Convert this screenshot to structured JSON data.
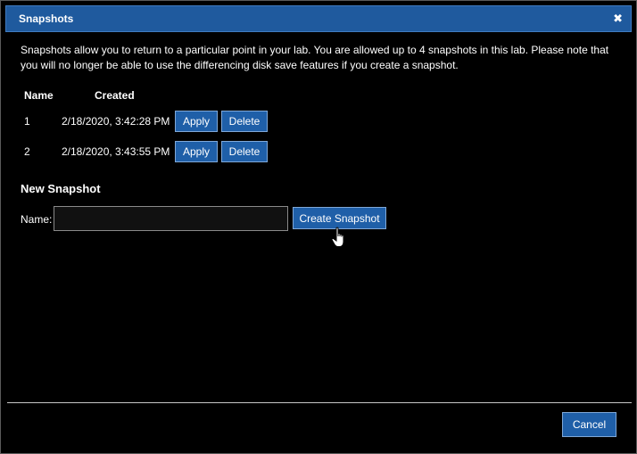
{
  "dialog": {
    "title": "Snapshots",
    "close_icon": "close-icon",
    "description": "Snapshots allow you to return to a particular point in your lab. You are allowed up to 4 snapshots in this lab. Please note that you will no longer be able to use the differencing disk save features if you create a snapshot."
  },
  "table": {
    "headers": {
      "name": "Name",
      "created": "Created"
    },
    "rows": [
      {
        "name": "1",
        "created": "2/18/2020, 3:42:28 PM",
        "apply": "Apply",
        "delete": "Delete"
      },
      {
        "name": "2",
        "created": "2/18/2020, 3:43:55 PM",
        "apply": "Apply",
        "delete": "Delete"
      }
    ]
  },
  "new_snapshot": {
    "title": "New Snapshot",
    "name_label": "Name:",
    "name_value": "",
    "name_placeholder": "",
    "create_label": "Create Snapshot"
  },
  "footer": {
    "cancel_label": "Cancel"
  },
  "colors": {
    "title_bar": "#1f5a9e",
    "button": "#1f5fa8",
    "background": "#000000",
    "text": "#ffffff"
  },
  "icons": {
    "close": "close-icon",
    "pointer": "hand-pointer-icon"
  }
}
